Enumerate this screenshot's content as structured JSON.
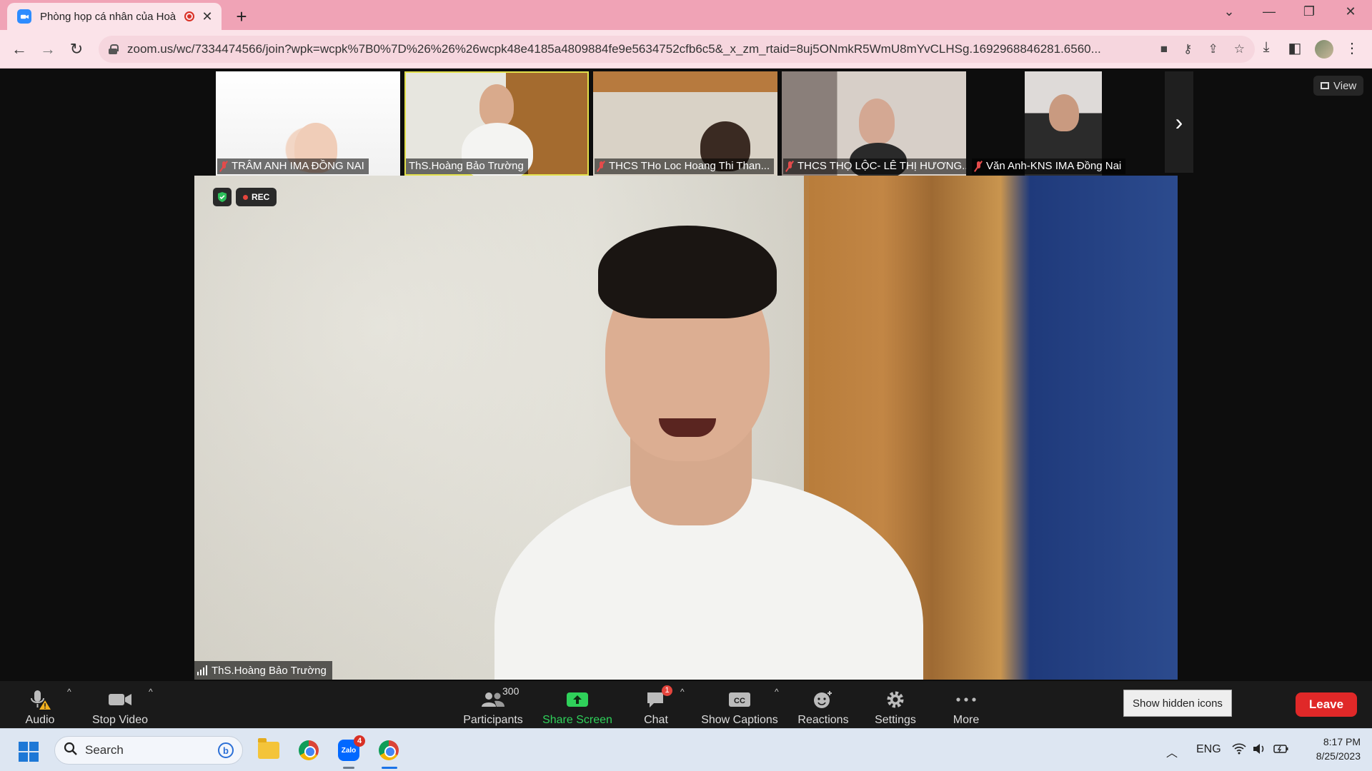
{
  "browser": {
    "tab_title": "Phòng họp cá nhân của Hoà",
    "url": "zoom.us/wc/7334474566/join?wpk=wcpk%7B0%7D%26%26%26wcpk48e4185a4809884fe9e5634752cfb6c5&_x_zm_rtaid=8uj5ONmkR5WmU8mYvCLHSg.1692968846281.6560..."
  },
  "meeting": {
    "participants": [
      {
        "name": "TRÂM ANH IMA ĐỒNG NAI",
        "muted": true
      },
      {
        "name": "ThS.Hoàng Bảo Trường",
        "muted": false
      },
      {
        "name": "THCS THo Loc Hoang Thi Than...",
        "muted": true
      },
      {
        "name": "THCS THỌ LỘC- LÊ THỊ HƯƠNG...",
        "muted": true
      },
      {
        "name": "Văn Anh-KNS IMA Đồng Nai",
        "muted": true
      }
    ],
    "view_label": "View",
    "rec_label": "REC",
    "active_speaker": "ThS.Hoàng Bảo Trường"
  },
  "toolbar": {
    "audio": "Audio",
    "stop_video": "Stop Video",
    "participants": "Participants",
    "participants_count": "300",
    "share_screen": "Share Screen",
    "chat": "Chat",
    "chat_badge": "1",
    "show_captions": "Show Captions",
    "reactions": "Reactions",
    "settings": "Settings",
    "more": "More",
    "show_hidden_icons": "Show hidden icons",
    "leave": "Leave"
  },
  "taskbar": {
    "search": "Search",
    "zalo_badge": "4",
    "language": "ENG",
    "time": "8:17 PM",
    "date": "8/25/2023"
  },
  "colors": {
    "tab_strip": "#f0a3b6",
    "leave": "#e02828",
    "share_green": "#2fd15a",
    "active_thumb_outline": "#e3e04b"
  }
}
